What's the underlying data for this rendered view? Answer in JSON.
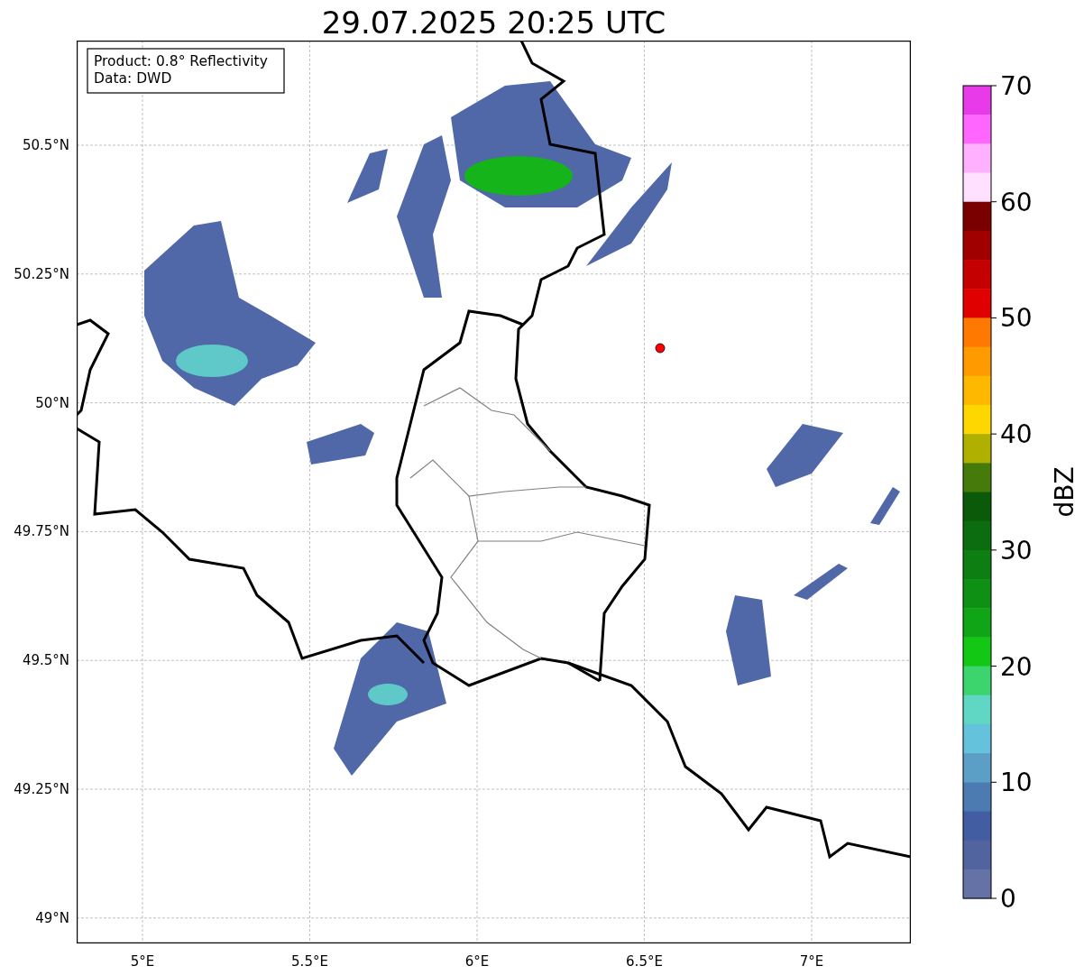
{
  "map": {
    "title": "29.07.2025 20:25 UTC",
    "x_tick_labels": [
      "5°E",
      "5.5°E",
      "6°E",
      "6.5°E",
      "7°E"
    ],
    "y_tick_labels": [
      "50.5°N",
      "50.25°N",
      "50°N",
      "49.75°N",
      "49.5°N",
      "49.25°N",
      "49°N"
    ],
    "annotation": [
      "Product: 0.8° Reflectivity",
      "Data: DWD"
    ]
  },
  "colorbar": {
    "label": "dBZ",
    "segments": [
      {
        "color": "#e83ae8"
      },
      {
        "color": "#ff66ff"
      },
      {
        "color": "#ffb0ff"
      },
      {
        "color": "#ffe0ff"
      },
      {
        "color": "#7a0000"
      },
      {
        "color": "#a00000"
      },
      {
        "color": "#c40000"
      },
      {
        "color": "#e00000"
      },
      {
        "color": "#ff7800"
      },
      {
        "color": "#ff9a00"
      },
      {
        "color": "#ffb800"
      },
      {
        "color": "#ffd700"
      },
      {
        "color": "#b0b000"
      },
      {
        "color": "#467a0a"
      },
      {
        "color": "#0a5a0a"
      },
      {
        "color": "#0b6c10"
      },
      {
        "color": "#0c7e12"
      },
      {
        "color": "#0e9014"
      },
      {
        "color": "#10a516"
      },
      {
        "color": "#12c814"
      },
      {
        "color": "#3cd46c"
      },
      {
        "color": "#60d6c5"
      },
      {
        "color": "#65c2dc"
      },
      {
        "color": "#5b9fc7"
      },
      {
        "color": "#4b7bb1"
      },
      {
        "color": "#435da2"
      },
      {
        "color": "#52649f"
      },
      {
        "color": "#6472a6"
      }
    ],
    "ticks": [
      "70",
      "60",
      "50",
      "40",
      "30",
      "20",
      "10",
      "0"
    ]
  }
}
